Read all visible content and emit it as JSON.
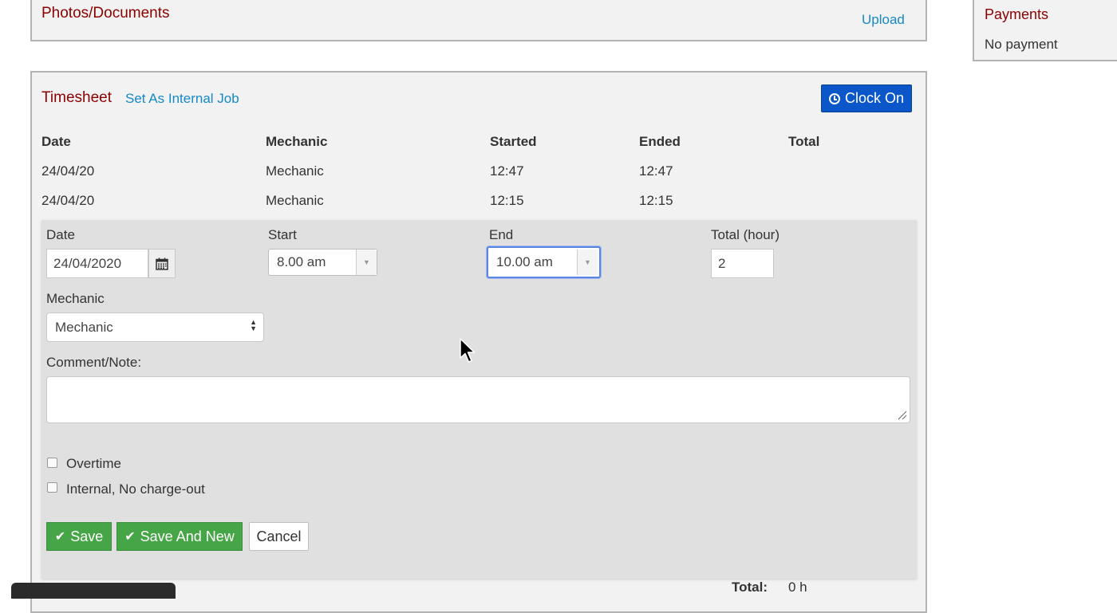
{
  "photos": {
    "title": "Photos/Documents",
    "upload_link": "Upload"
  },
  "payments": {
    "title": "Payments",
    "status": "No payment"
  },
  "timesheet": {
    "title": "Timesheet",
    "internal_job_link": "Set As Internal Job",
    "clock_on_label": "Clock On",
    "columns": [
      "Date",
      "Mechanic",
      "Started",
      "Ended",
      "Total"
    ],
    "rows": [
      {
        "date": "24/04/20",
        "mechanic": "Mechanic",
        "started": "12:47",
        "ended": "12:47",
        "total": ""
      },
      {
        "date": "24/04/20",
        "mechanic": "Mechanic",
        "started": "12:15",
        "ended": "12:15",
        "total": ""
      }
    ],
    "form": {
      "date_label": "Date",
      "date_value": "24/04/2020",
      "start_label": "Start",
      "start_value": "8.00 am",
      "end_label": "End",
      "end_value": "10.00 am",
      "total_label": "Total (hour)",
      "total_value": "2",
      "mechanic_label": "Mechanic",
      "mechanic_value": "Mechanic",
      "comment_label": "Comment/Note:",
      "comment_value": "",
      "overtime_label": "Overtime",
      "internal_label": "Internal, No charge-out",
      "save_label": "Save",
      "save_new_label": "Save And New",
      "cancel_label": "Cancel"
    },
    "footer_total_label": "Total:",
    "footer_total_value": "0 h"
  },
  "colors": {
    "title": "#8b0000",
    "link": "#1589c6",
    "primary": "#0b57c9",
    "success": "#46a546"
  },
  "icons": [
    "clock-icon",
    "calendar-icon",
    "check-icon",
    "mouse-cursor-icon"
  ]
}
